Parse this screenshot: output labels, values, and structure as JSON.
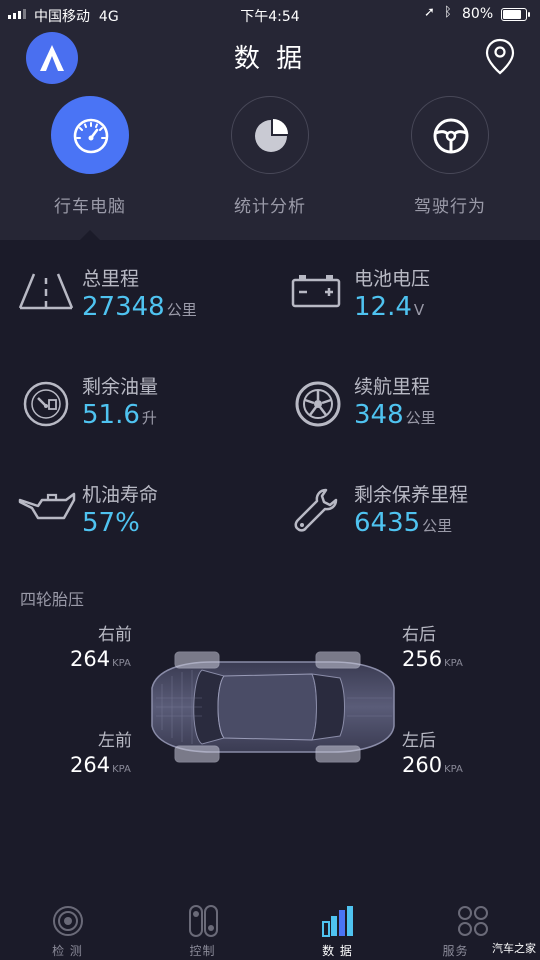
{
  "status_bar": {
    "carrier": "中国移动",
    "network": "4G",
    "time": "下午4:54",
    "battery_percent": "80%",
    "battery_level": 0.8
  },
  "header": {
    "title": "数 据"
  },
  "tabs": [
    {
      "label": "行车电脑",
      "icon": "speedometer-icon",
      "active": true
    },
    {
      "label": "统计分析",
      "icon": "pie-chart-icon",
      "active": false
    },
    {
      "label": "驾驶行为",
      "icon": "steering-wheel-icon",
      "active": false
    }
  ],
  "metrics": {
    "total_mileage": {
      "label": "总里程",
      "value": "27348",
      "unit": "公里"
    },
    "battery_voltage": {
      "label": "电池电压",
      "value": "12.4",
      "unit": "V"
    },
    "fuel_left": {
      "label": "剩余油量",
      "value": "51.6",
      "unit": "升"
    },
    "range": {
      "label": "续航里程",
      "value": "348",
      "unit": "公里"
    },
    "oil_life": {
      "label": "机油寿命",
      "value": "57%",
      "unit": ""
    },
    "service_left": {
      "label": "剩余保养里程",
      "value": "6435",
      "unit": "公里"
    }
  },
  "tire_pressure": {
    "title": "四轮胎压",
    "front_right": {
      "label": "右前",
      "value": "264",
      "unit": "KPA"
    },
    "rear_right": {
      "label": "右后",
      "value": "256",
      "unit": "KPA"
    },
    "front_left": {
      "label": "左前",
      "value": "264",
      "unit": "KPA"
    },
    "rear_left": {
      "label": "左后",
      "value": "260",
      "unit": "KPA"
    }
  },
  "bottom_nav": [
    {
      "label": "检 测",
      "icon": "inspection-icon",
      "active": false
    },
    {
      "label": "控制",
      "icon": "control-icon",
      "active": false
    },
    {
      "label": "数 据",
      "icon": "data-bars-icon",
      "active": true
    },
    {
      "label": "服务",
      "icon": "services-grid-icon",
      "active": false
    }
  ],
  "watermark": "汽车之家",
  "colors": {
    "accent": "#4a74f5",
    "value": "#4fc3f0",
    "background": "#1b1b29",
    "panel": "#262635"
  }
}
